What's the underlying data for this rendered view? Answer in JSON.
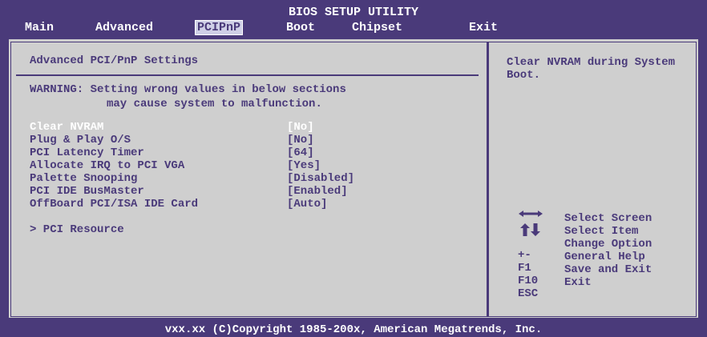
{
  "header": {
    "title": "BIOS SETUP UTILITY",
    "tabs": [
      {
        "label": "Main"
      },
      {
        "label": "Advanced"
      },
      {
        "label": "PCIPnP",
        "selected": true
      },
      {
        "label": "Boot"
      },
      {
        "label": "Chipset"
      },
      {
        "label": "Exit"
      }
    ]
  },
  "main": {
    "heading": "Advanced PCI/PnP Settings",
    "warning_line1": "WARNING: Setting wrong values in below sections",
    "warning_line2": "may cause system to malfunction.",
    "items": [
      {
        "label": "Clear NVRAM",
        "value": "[No]",
        "highlighted": true
      },
      {
        "label": "Plug & Play O/S",
        "value": "[No]"
      },
      {
        "label": "PCI Latency Timer",
        "value": "[64]"
      },
      {
        "label": "Allocate IRQ to PCI VGA",
        "value": "[Yes]"
      },
      {
        "label": "Palette Snooping",
        "value": "[Disabled]"
      },
      {
        "label": "PCI IDE BusMaster",
        "value": "[Enabled]"
      },
      {
        "label": "OffBoard PCI/ISA IDE Card",
        "value": "[Auto]"
      }
    ],
    "submenu": "> PCI Resource"
  },
  "help": {
    "text": "Clear NVRAM during System Boot."
  },
  "keys": [
    {
      "key": "",
      "icon": "left-right-arrows-icon",
      "desc": "Select Screen"
    },
    {
      "key": "",
      "icon": "up-down-arrows-icon",
      "desc": "Select Item"
    },
    {
      "key": "+-",
      "desc": "Change Option"
    },
    {
      "key": "F1",
      "desc": "General Help"
    },
    {
      "key": "F10",
      "desc": "Save and Exit"
    },
    {
      "key": "ESC",
      "desc": "Exit"
    }
  ],
  "footer": {
    "text": "vxx.xx (C)Copyright 1985-200x, American Megatrends, Inc."
  },
  "colors": {
    "frame": "#4a3a7a",
    "panel": "#cfcfcf",
    "highlight_text": "#ffffff",
    "selected_tab_bg": "#cfcfe6"
  }
}
